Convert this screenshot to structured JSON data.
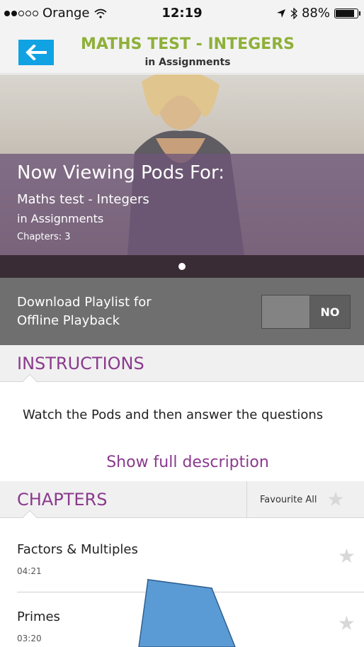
{
  "status_bar": {
    "carrier": "Orange",
    "time": "12:19",
    "battery": "88%",
    "battery_level": 0.88,
    "icons": [
      "signal-icon",
      "wifi-icon",
      "location-icon",
      "bluetooth-icon",
      "battery-icon"
    ]
  },
  "nav": {
    "title": "MATHS TEST - INTEGERS",
    "subtitle": "in Assignments",
    "back_icon": "arrow-left-icon"
  },
  "hero": {
    "heading": "Now Viewing Pods For:",
    "title": "Maths test - Integers",
    "subtitle": "in Assignments",
    "chapters": "Chapters: 3"
  },
  "download": {
    "label_line1": "Download Playlist for",
    "label_line2": "Offline Playback",
    "toggle_value": "NO"
  },
  "instructions": {
    "header": "INSTRUCTIONS",
    "text": "Watch the Pods and then answer the questions",
    "show_more": "Show full description"
  },
  "chapters": {
    "header": "CHAPTERS",
    "favourite_all": "Favourite All",
    "items": [
      {
        "title": "Factors & Multiples",
        "duration": "04:21"
      },
      {
        "title": "Primes",
        "duration": "03:20"
      }
    ]
  },
  "colors": {
    "accent_green": "#8fb03a",
    "accent_purple": "#8a3a8d",
    "back_button_blue": "#10a2e3",
    "annotation_arrow": "#5b9bd5"
  }
}
